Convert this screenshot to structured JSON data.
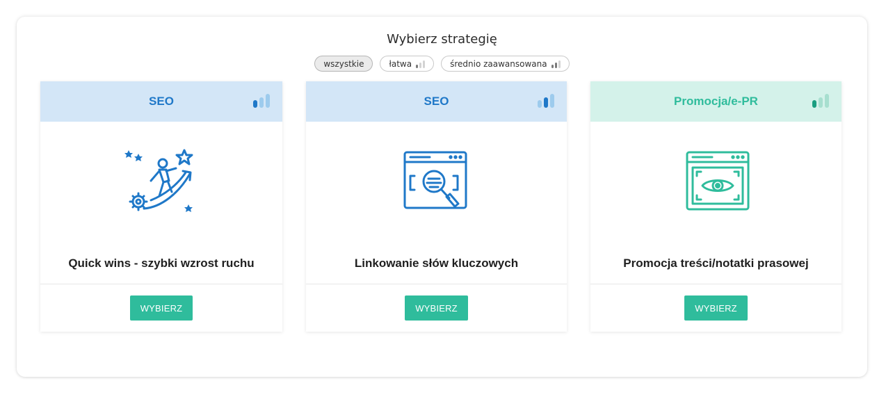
{
  "title": "Wybierz strategię",
  "filters": [
    {
      "label": "wszystkie",
      "active": true
    },
    {
      "label": "łatwa",
      "level": 1
    },
    {
      "label": "średnio zaawansowana",
      "level": 2
    }
  ],
  "colors": {
    "seo_header_bg": "#d3e6f7",
    "seo_text": "#1f78c8",
    "promo_header_bg": "#d4f2ea",
    "promo_text": "#2fbc9c",
    "button_bg": "#2fbc9c",
    "bar_inactive_blue": "#9dcbed",
    "bar_inactive_green": "#a7dfcf"
  },
  "cards": [
    {
      "category": "SEO",
      "title": "Quick wins - szybki wzrost ruchu",
      "button": "WYBIERZ",
      "difficulty": 1,
      "icon": "growth-climber-icon"
    },
    {
      "category": "SEO",
      "title": "Linkowanie słów kluczowych",
      "button": "WYBIERZ",
      "difficulty": 2,
      "icon": "browser-search-icon"
    },
    {
      "category": "Promocja/e-PR",
      "title": "Promocja treści/notatki prasowej",
      "button": "WYBIERZ",
      "difficulty": 1,
      "icon": "browser-eye-icon"
    }
  ]
}
